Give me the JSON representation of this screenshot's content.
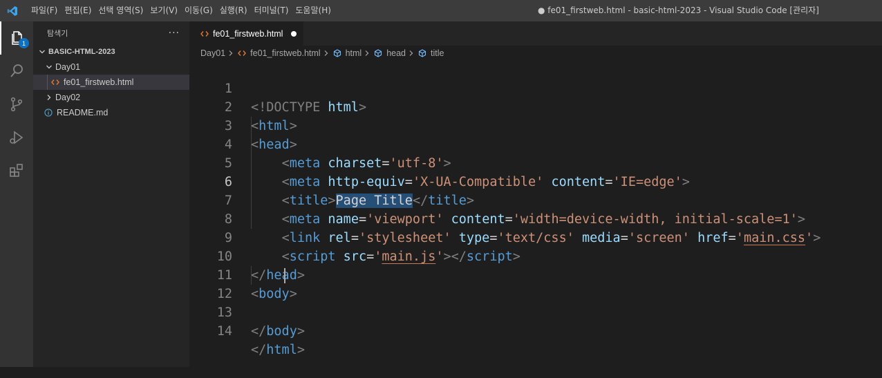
{
  "titlebar": {
    "menu": [
      "파일(F)",
      "편집(E)",
      "선택 영역(S)",
      "보기(V)",
      "이동(G)",
      "실행(R)",
      "터미널(T)",
      "도움말(H)"
    ],
    "window_title": "● fe01_firstweb.html - basic-html-2023 - Visual Studio Code [관리자]"
  },
  "activitybar": {
    "items": [
      "explorer-icon",
      "search-icon",
      "source-control-icon",
      "run-debug-icon",
      "extensions-icon"
    ],
    "explorer_badge": "1"
  },
  "sidebar": {
    "title": "탐색기",
    "more": "···",
    "root": "BASIC-HTML-2023",
    "items": [
      {
        "label": "Day01"
      },
      {
        "label": "fe01_firstweb.html"
      },
      {
        "label": "Day02"
      },
      {
        "label": "README.md"
      }
    ]
  },
  "editor": {
    "tab_label": "fe01_firstweb.html",
    "breadcrumb": [
      "Day01",
      "fe01_firstweb.html",
      "html",
      "head",
      "title"
    ],
    "line_numbers": [
      "1",
      "2",
      "3",
      "4",
      "5",
      "6",
      "7",
      "8",
      "9",
      "10",
      "11",
      "12",
      "13",
      "14"
    ],
    "current_line": "6",
    "tok": {
      "lt": "<",
      "gt": ">",
      "lts": "</",
      "eq": "=",
      "sp": " ",
      "ind": "    ",
      "doctype": "<!DOCTYPE",
      "html": "html",
      "head": "head",
      "meta": "meta",
      "title": "title",
      "link": "link",
      "script": "script",
      "body": "body",
      "charset": "charset",
      "utf8": "'utf-8'",
      "http_equiv": "http-equiv",
      "xua": "'X-UA-Compatible'",
      "content": "content",
      "ieedge": "'IE=edge'",
      "page_title": "Page Title",
      "name": "name",
      "viewport": "'viewport'",
      "vp_content": "'width=device-width, initial-scale=1'",
      "rel": "rel",
      "stylesheet": "'stylesheet'",
      "type": "type",
      "textcss": "'text/css'",
      "media": "media",
      "screen": "'screen'",
      "href": "href",
      "q": "'",
      "maincss": "main.css",
      "src": "src",
      "mainjs": "main.js"
    }
  },
  "colors": {
    "tag": "#569cd6",
    "attribute": "#9cdcfe",
    "string": "#ce9178",
    "punctuation": "#808080",
    "selection": "#264f78"
  }
}
